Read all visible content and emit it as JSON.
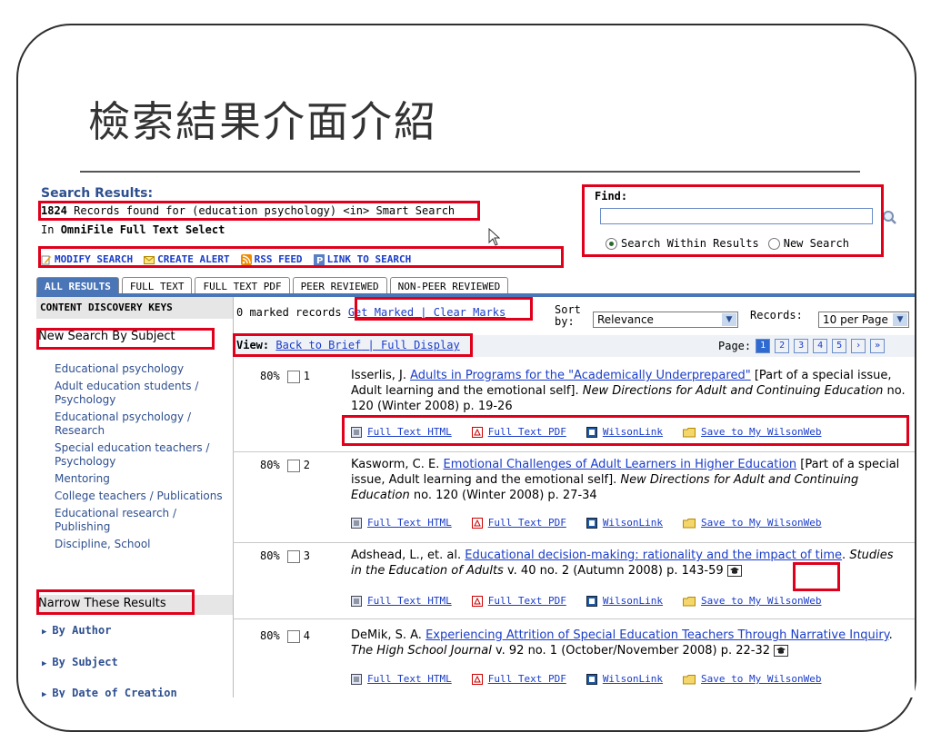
{
  "slide": {
    "title": "檢索結果介面介紹"
  },
  "search": {
    "label": "Search Results:",
    "count": "1824",
    "records_text": " Records found for (education psychology) <in> Smart Search",
    "in_prefix": "In ",
    "in_db": "OmniFile Full Text Select"
  },
  "toolbar": {
    "modify": "MODIFY SEARCH",
    "alert": "CREATE ALERT",
    "rss": "RSS FEED",
    "link": "LINK TO SEARCH"
  },
  "find": {
    "label": "Find:",
    "value": "",
    "within": "Search Within Results",
    "new": "New Search"
  },
  "tabs": [
    "ALL RESULTS",
    "FULL TEXT",
    "FULL TEXT PDF",
    "PEER REVIEWED",
    "NON-PEER REVIEWED"
  ],
  "sidebar": {
    "header": "CONTENT DISCOVERY KEYS",
    "new_by_subject": "New Search By Subject",
    "subjects": [
      "Educational psychology",
      "Adult education students / Psychology",
      "Educational psychology / Research",
      "Special education teachers / Psychology",
      "Mentoring",
      "College teachers / Publications",
      "Educational research / Publishing",
      "Discipline, School"
    ],
    "narrow": "Narrow These Results",
    "facets": [
      "By Author",
      "By Subject",
      "By Date of Creation"
    ]
  },
  "marks": {
    "count_text": "0 marked records",
    "get": "Get Marked",
    "sep": " | ",
    "clear": "Clear Marks"
  },
  "sort": {
    "label": "Sort by:",
    "value": "Relevance",
    "records_label": "Records:",
    "records_value": "10 per Page"
  },
  "view": {
    "label": "View:",
    "brief": "Back to Brief",
    "sep": " | ",
    "full": "Full Display"
  },
  "pager": {
    "label": "Page:",
    "pages": [
      "1",
      "2",
      "3",
      "4",
      "5"
    ],
    "next": "›",
    "last": "»"
  },
  "link_labels": {
    "html": "Full Text HTML",
    "pdf": "Full Text PDF",
    "wilson": "WilsonLink",
    "save": "Save to My WilsonWeb"
  },
  "results": [
    {
      "score": "80%",
      "num": "1",
      "author": "Isserlis, J.",
      "title": "Adults in Programs for the \"Academically Underprepared\"",
      "rest": " [Part of a special issue, Adult learning and the emotional self]. ",
      "journal": "New Directions for Adult and Continuing Education",
      "source": " no. 120 (Winter 2008) p. 19-26"
    },
    {
      "score": "80%",
      "num": "2",
      "author": "Kasworm, C. E.",
      "title": "Emotional Challenges of Adult Learners in Higher Education",
      "rest": " [Part of a special issue, Adult learning and the emotional self]. ",
      "journal": "New Directions for Adult and Continuing Education",
      "source": " no. 120 (Winter 2008) p. 27-34"
    },
    {
      "score": "80%",
      "num": "3",
      "author": "Adshead, L., et. al.",
      "title": "Educational decision-making: rationality and the impact of time",
      "rest": ". ",
      "journal": "Studies in the Education of Adults",
      "source": " v. 40 no. 2 (Autumn 2008) p. 143-59"
    },
    {
      "score": "80%",
      "num": "4",
      "author": "DeMik, S. A.",
      "title": "Experiencing Attrition of Special Education Teachers Through Narrative Inquiry",
      "rest": ". ",
      "journal": "The High School Journal",
      "source": " v. 92 no. 1 (October/November 2008) p. 22-32"
    }
  ]
}
